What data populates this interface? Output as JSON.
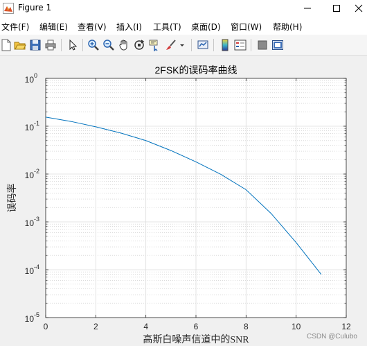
{
  "window": {
    "title": "Figure 1",
    "controls": {
      "minimize": "–",
      "maximize": "□",
      "close": "✕"
    }
  },
  "menubar": {
    "items": [
      {
        "label": "文件(F)"
      },
      {
        "label": "编辑(E)"
      },
      {
        "label": "查看(V)"
      },
      {
        "label": "插入(I)"
      },
      {
        "label": "工具(T)"
      },
      {
        "label": "桌面(D)"
      },
      {
        "label": "窗口(W)"
      },
      {
        "label": "帮助(H)"
      }
    ]
  },
  "toolbar": {
    "icons": [
      "new-figure-icon",
      "open-file-icon",
      "save-icon",
      "print-icon",
      "select-arrow-icon",
      "zoom-in-icon",
      "zoom-out-icon",
      "pan-hand-icon",
      "rotate-3d-icon",
      "data-cursor-icon",
      "brush-icon",
      "brush-dropdown-icon",
      "link-plot-icon",
      "colorbar-icon",
      "legend-icon",
      "hide-plot-tools-icon",
      "show-plot-tools-icon"
    ]
  },
  "chart_data": {
    "type": "line",
    "title": "2FSK的误码率曲线",
    "xlabel": "高斯白噪声信道中的SNR",
    "ylabel": "误码率",
    "xlim": [
      0,
      12
    ],
    "ylim": [
      1e-05,
      1
    ],
    "yscale": "log",
    "grid": true,
    "minor_grid": true,
    "xticks": [
      0,
      2,
      4,
      6,
      8,
      10,
      12
    ],
    "yticks": [
      {
        "base": "10",
        "exp": "0",
        "value": 1
      },
      {
        "base": "10",
        "exp": "-1",
        "value": 0.1
      },
      {
        "base": "10",
        "exp": "-2",
        "value": 0.01
      },
      {
        "base": "10",
        "exp": "-3",
        "value": 0.001
      },
      {
        "base": "10",
        "exp": "-4",
        "value": 0.0001
      },
      {
        "base": "10",
        "exp": "-5",
        "value": 1e-05
      }
    ],
    "series": [
      {
        "color": "#0072bd",
        "x": [
          0,
          1,
          2,
          3,
          4,
          5,
          6,
          7,
          8,
          9,
          10,
          11
        ],
        "y": [
          0.155,
          0.126,
          0.097,
          0.072,
          0.05,
          0.031,
          0.018,
          0.0098,
          0.0047,
          0.0015,
          0.00037,
          8e-05
        ]
      }
    ]
  },
  "watermark": "CSDN @Culubo"
}
